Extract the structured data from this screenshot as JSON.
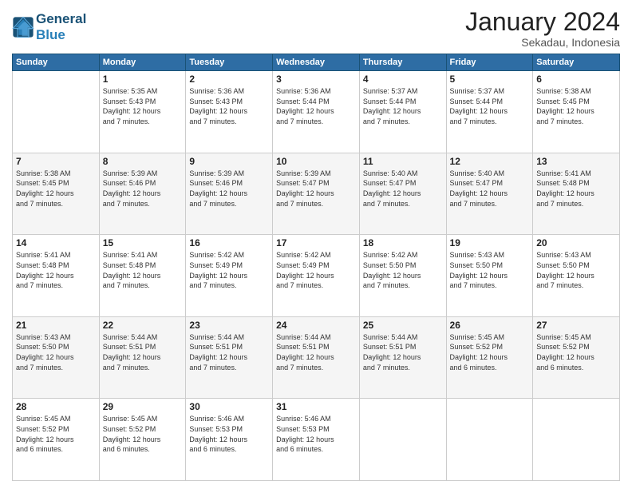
{
  "logo": {
    "line1": "General",
    "line2": "Blue"
  },
  "title": "January 2024",
  "subtitle": "Sekadau, Indonesia",
  "headers": [
    "Sunday",
    "Monday",
    "Tuesday",
    "Wednesday",
    "Thursday",
    "Friday",
    "Saturday"
  ],
  "weeks": [
    [
      {
        "day": "",
        "info": ""
      },
      {
        "day": "1",
        "info": "Sunrise: 5:35 AM\nSunset: 5:43 PM\nDaylight: 12 hours\nand 7 minutes."
      },
      {
        "day": "2",
        "info": "Sunrise: 5:36 AM\nSunset: 5:43 PM\nDaylight: 12 hours\nand 7 minutes."
      },
      {
        "day": "3",
        "info": "Sunrise: 5:36 AM\nSunset: 5:44 PM\nDaylight: 12 hours\nand 7 minutes."
      },
      {
        "day": "4",
        "info": "Sunrise: 5:37 AM\nSunset: 5:44 PM\nDaylight: 12 hours\nand 7 minutes."
      },
      {
        "day": "5",
        "info": "Sunrise: 5:37 AM\nSunset: 5:44 PM\nDaylight: 12 hours\nand 7 minutes."
      },
      {
        "day": "6",
        "info": "Sunrise: 5:38 AM\nSunset: 5:45 PM\nDaylight: 12 hours\nand 7 minutes."
      }
    ],
    [
      {
        "day": "7",
        "info": "Sunrise: 5:38 AM\nSunset: 5:45 PM\nDaylight: 12 hours\nand 7 minutes."
      },
      {
        "day": "8",
        "info": "Sunrise: 5:39 AM\nSunset: 5:46 PM\nDaylight: 12 hours\nand 7 minutes."
      },
      {
        "day": "9",
        "info": "Sunrise: 5:39 AM\nSunset: 5:46 PM\nDaylight: 12 hours\nand 7 minutes."
      },
      {
        "day": "10",
        "info": "Sunrise: 5:39 AM\nSunset: 5:47 PM\nDaylight: 12 hours\nand 7 minutes."
      },
      {
        "day": "11",
        "info": "Sunrise: 5:40 AM\nSunset: 5:47 PM\nDaylight: 12 hours\nand 7 minutes."
      },
      {
        "day": "12",
        "info": "Sunrise: 5:40 AM\nSunset: 5:47 PM\nDaylight: 12 hours\nand 7 minutes."
      },
      {
        "day": "13",
        "info": "Sunrise: 5:41 AM\nSunset: 5:48 PM\nDaylight: 12 hours\nand 7 minutes."
      }
    ],
    [
      {
        "day": "14",
        "info": "Sunrise: 5:41 AM\nSunset: 5:48 PM\nDaylight: 12 hours\nand 7 minutes."
      },
      {
        "day": "15",
        "info": "Sunrise: 5:41 AM\nSunset: 5:48 PM\nDaylight: 12 hours\nand 7 minutes."
      },
      {
        "day": "16",
        "info": "Sunrise: 5:42 AM\nSunset: 5:49 PM\nDaylight: 12 hours\nand 7 minutes."
      },
      {
        "day": "17",
        "info": "Sunrise: 5:42 AM\nSunset: 5:49 PM\nDaylight: 12 hours\nand 7 minutes."
      },
      {
        "day": "18",
        "info": "Sunrise: 5:42 AM\nSunset: 5:50 PM\nDaylight: 12 hours\nand 7 minutes."
      },
      {
        "day": "19",
        "info": "Sunrise: 5:43 AM\nSunset: 5:50 PM\nDaylight: 12 hours\nand 7 minutes."
      },
      {
        "day": "20",
        "info": "Sunrise: 5:43 AM\nSunset: 5:50 PM\nDaylight: 12 hours\nand 7 minutes."
      }
    ],
    [
      {
        "day": "21",
        "info": "Sunrise: 5:43 AM\nSunset: 5:50 PM\nDaylight: 12 hours\nand 7 minutes."
      },
      {
        "day": "22",
        "info": "Sunrise: 5:44 AM\nSunset: 5:51 PM\nDaylight: 12 hours\nand 7 minutes."
      },
      {
        "day": "23",
        "info": "Sunrise: 5:44 AM\nSunset: 5:51 PM\nDaylight: 12 hours\nand 7 minutes."
      },
      {
        "day": "24",
        "info": "Sunrise: 5:44 AM\nSunset: 5:51 PM\nDaylight: 12 hours\nand 7 minutes."
      },
      {
        "day": "25",
        "info": "Sunrise: 5:44 AM\nSunset: 5:51 PM\nDaylight: 12 hours\nand 7 minutes."
      },
      {
        "day": "26",
        "info": "Sunrise: 5:45 AM\nSunset: 5:52 PM\nDaylight: 12 hours\nand 6 minutes."
      },
      {
        "day": "27",
        "info": "Sunrise: 5:45 AM\nSunset: 5:52 PM\nDaylight: 12 hours\nand 6 minutes."
      }
    ],
    [
      {
        "day": "28",
        "info": "Sunrise: 5:45 AM\nSunset: 5:52 PM\nDaylight: 12 hours\nand 6 minutes."
      },
      {
        "day": "29",
        "info": "Sunrise: 5:45 AM\nSunset: 5:52 PM\nDaylight: 12 hours\nand 6 minutes."
      },
      {
        "day": "30",
        "info": "Sunrise: 5:46 AM\nSunset: 5:53 PM\nDaylight: 12 hours\nand 6 minutes."
      },
      {
        "day": "31",
        "info": "Sunrise: 5:46 AM\nSunset: 5:53 PM\nDaylight: 12 hours\nand 6 minutes."
      },
      {
        "day": "",
        "info": ""
      },
      {
        "day": "",
        "info": ""
      },
      {
        "day": "",
        "info": ""
      }
    ]
  ]
}
